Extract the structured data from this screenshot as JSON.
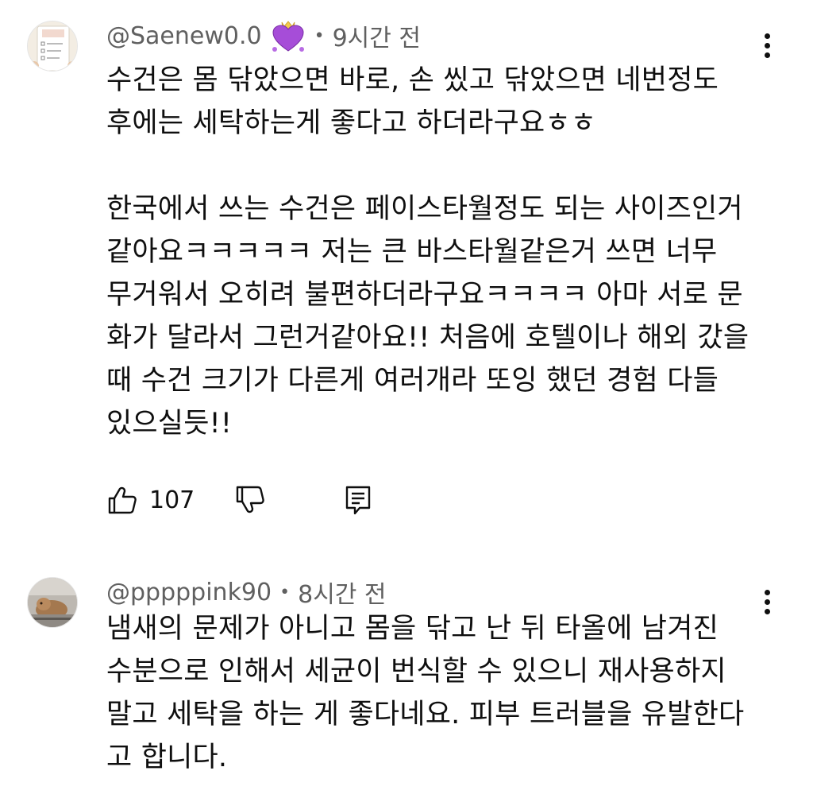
{
  "comments": [
    {
      "author": "@Saenew0.0",
      "time": "9시간 전",
      "separator": "•",
      "avatar_text": "오늘 할일목록",
      "text": "수건은 몸 닦았으면 바로, 손 씼고 닦았으면 네번정도\n후에는 세탁하는게 좋다고 하더라구요ㅎㅎ\n\n한국에서 쓰는 수건은 페이스타월정도 되는 사이즈인거\n같아요ㅋㅋㅋㅋㅋ 저는 큰 바스타월같은거 쓰면 너무\n무거워서 오히려 불편하더라구요ㅋㅋㅋㅋ 아마 서로 문\n화가 달라서 그런거같아요!! 처음에 호텔이나 해외 갔을\n때 수건 크기가 다른게 여러개라 또잉 했던 경험 다들\n있으실듯!!",
      "likes": "107",
      "badge_icon": "purple-heart-crown-badge",
      "colors": {
        "badge": "#a64dd8"
      }
    },
    {
      "author": "@pppppink90",
      "time": "8시간 전",
      "separator": "•",
      "text": "냄새의 문제가 아니고 몸을 닦고 난 뒤 타올에 남겨진\n수분으로 인해서 세균이 번식할 수 있으니 재사용하지\n말고 세탁을 하는 게 좋다네요. 피부 트러블을 유발한다\n고 합니다."
    }
  ],
  "icons": {
    "like": "thumbs-up-icon",
    "dislike": "thumbs-down-icon",
    "reply": "reply-comment-icon",
    "more": "more-vertical-icon"
  }
}
